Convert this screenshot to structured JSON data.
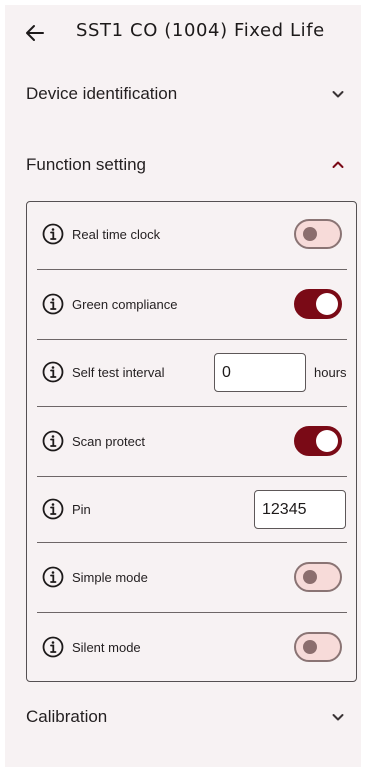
{
  "app_bar": {
    "title": "SST1 CO (1004) Fixed Life",
    "back_icon": "arrow-left-icon"
  },
  "sections": {
    "device_identification": {
      "title": "Device identification",
      "expanded": false
    },
    "function_setting": {
      "title": "Function setting",
      "expanded": true,
      "rows": {
        "real_time_clock": {
          "label": "Real time clock",
          "state": "off"
        },
        "green_compliance": {
          "label": "Green compliance",
          "state": "on"
        },
        "self_test_interval": {
          "label": "Self test interval",
          "value": "0",
          "unit": "hours"
        },
        "scan_protect": {
          "label": "Scan protect",
          "state": "on"
        },
        "pin": {
          "label": "Pin",
          "value": "12345"
        },
        "simple_mode": {
          "label": "Simple mode",
          "state": "off"
        },
        "silent_mode": {
          "label": "Silent mode",
          "state": "off"
        }
      }
    },
    "calibration": {
      "title": "Calibration",
      "expanded": false
    }
  },
  "colors": {
    "background": "#f7f2f3",
    "accent": "#7a0a16",
    "toggle_off_track": "#f7dbd9",
    "toggle_off_knob": "#8b6e6e",
    "text": "#231f20"
  },
  "icons": {
    "info": "info-circle-icon",
    "chevron_down": "chevron-down-icon",
    "chevron_up": "chevron-up-icon"
  }
}
